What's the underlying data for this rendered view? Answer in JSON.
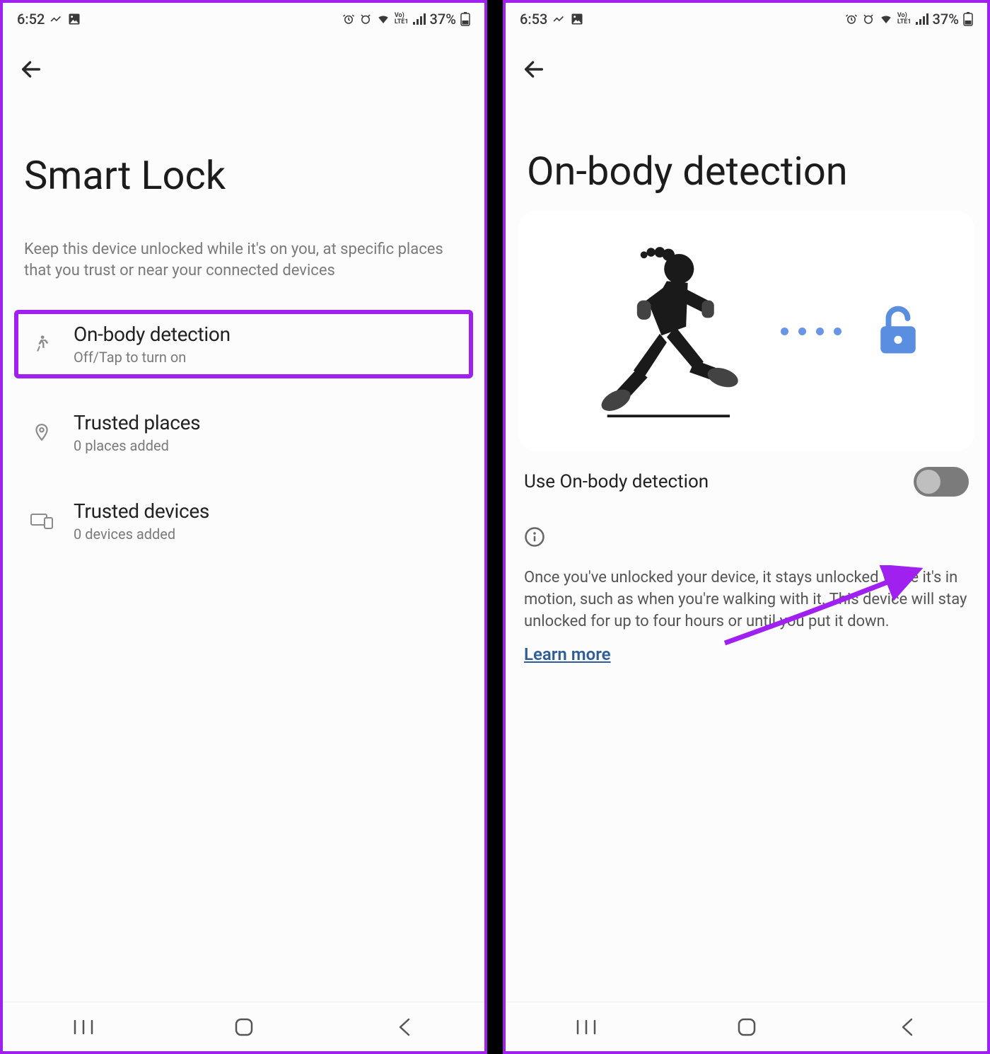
{
  "left": {
    "status": {
      "time": "6:52",
      "battery_pct": "37%"
    },
    "title": "Smart Lock",
    "subtitle": "Keep this device unlocked while it's on you, at specific places that you trust or near your connected devices",
    "items": [
      {
        "title": "On-body detection",
        "sub": "Off/Tap to turn on"
      },
      {
        "title": "Trusted places",
        "sub": "0 places added"
      },
      {
        "title": "Trusted devices",
        "sub": "0 devices added"
      }
    ]
  },
  "right": {
    "status": {
      "time": "6:53",
      "battery_pct": "37%"
    },
    "title": "On-body detection",
    "toggle_label": "Use On-body detection",
    "toggle_on": false,
    "info_text": "Once you've unlocked your device, it stays unlocked while it's in motion, such as when you're walking with it. This device will stay unlocked for up to four hours or until you put it down.",
    "learn_more": "Learn more"
  }
}
